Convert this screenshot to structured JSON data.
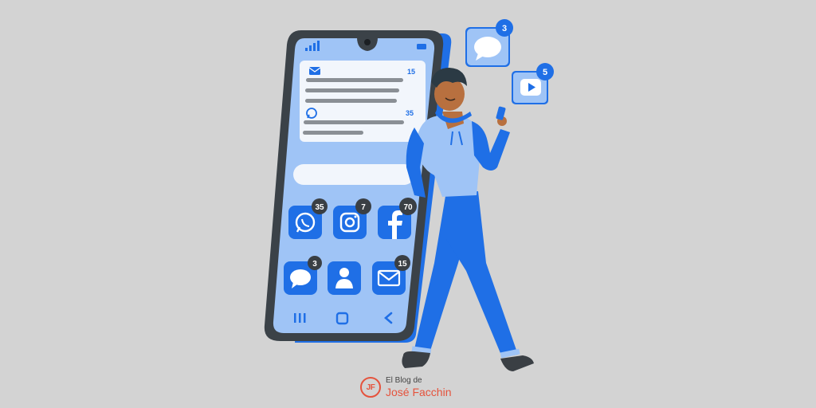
{
  "colors": {
    "background": "#d3d3d3",
    "accent_blue": "#1f6fe6",
    "light_blue": "#9fc4f6",
    "phone_frame": "#3b4248",
    "badge_dark": "#3a3f44",
    "brand_red": "#e5533d"
  },
  "notifications": {
    "email_count": "15",
    "whatsapp_count": "35"
  },
  "apps": [
    {
      "name": "whatsapp",
      "icon": "whatsapp-icon",
      "badge": "35"
    },
    {
      "name": "instagram",
      "icon": "instagram-icon",
      "badge": "7"
    },
    {
      "name": "facebook",
      "icon": "facebook-icon",
      "badge": "70"
    },
    {
      "name": "messages",
      "icon": "chat-bubble-icon",
      "badge": "3"
    },
    {
      "name": "contacts",
      "icon": "user-icon",
      "badge": ""
    },
    {
      "name": "mail",
      "icon": "envelope-icon",
      "badge": "15"
    }
  ],
  "floating": {
    "chat_badge": "3",
    "video_badge": "5"
  },
  "brand": {
    "logo_initials": "JF",
    "line1": "El Blog de",
    "line2": "José Facchin"
  }
}
